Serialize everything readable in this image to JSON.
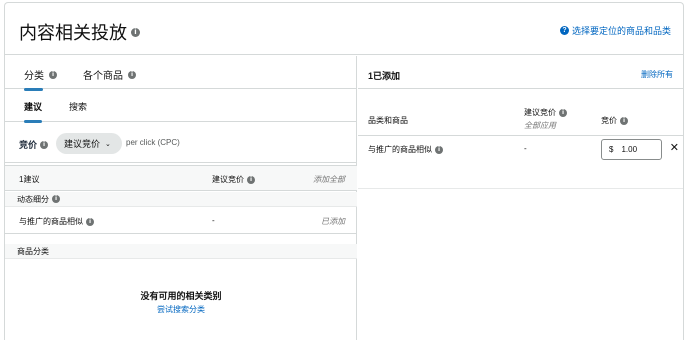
{
  "header": {
    "title": "内容相关投放",
    "link": "选择要定位的商品和品类"
  },
  "left": {
    "tabs": [
      "分类",
      "各个商品"
    ],
    "subtabs": [
      "建议",
      "搜索"
    ],
    "bid": {
      "label": "竞价",
      "select_value": "建议竞价",
      "unit": "per click (CPC)"
    },
    "table": {
      "col_suggestion": "1建议",
      "col_suggested_bid": "建议竞价",
      "add_all": "添加全部"
    },
    "sections": {
      "dynamic": "动态细分",
      "category": "商品分类"
    },
    "rows": [
      {
        "name": "与推广的商品相似",
        "bid": "-",
        "status": "已添加"
      }
    ],
    "empty": {
      "title": "没有可用的相关类别",
      "link": "尝试搜索分类"
    }
  },
  "right": {
    "count": "1已添加",
    "remove_all": "删除所有",
    "columns": {
      "category_product": "品类和商品",
      "suggested_bid": "建议竞价",
      "apply_all": "全部应用",
      "bid": "竞价"
    },
    "rows": [
      {
        "name": "与推广的商品相似",
        "suggested": "-",
        "currency": "$",
        "bid_value": "1.00"
      }
    ]
  },
  "colors": {
    "accent": "#2a7db8",
    "link": "#0066c0",
    "border": "#d5d9d9"
  }
}
